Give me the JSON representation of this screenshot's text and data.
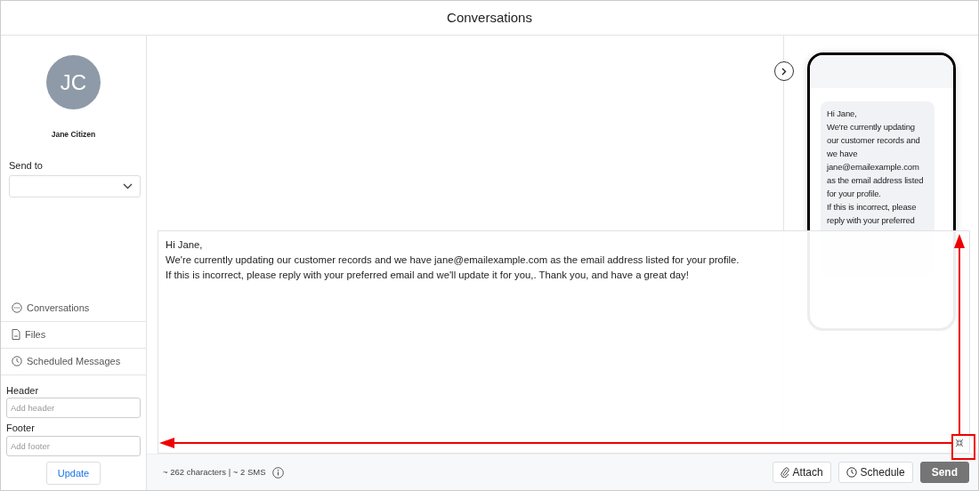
{
  "window": {
    "title": "Conversations"
  },
  "contact": {
    "initials": "JC",
    "name": "Jane Citizen"
  },
  "send_to": {
    "label": "Send to"
  },
  "nav": [
    {
      "label": "Conversations"
    },
    {
      "label": "Files"
    },
    {
      "label": "Scheduled Messages"
    }
  ],
  "header_field": {
    "label": "Header",
    "placeholder": "Add header"
  },
  "footer_field": {
    "label": "Footer",
    "placeholder": "Add footer"
  },
  "update_button": "Update",
  "preview": {
    "message": "Hi Jane,\nWe're currently updating our customer records and we have jane@emailexample.com as the email address listed for your profile.\nIf this is incorrect, please reply with your preferred"
  },
  "composer": {
    "message": "Hi Jane,\nWe're currently updating our customer records and we have jane@emailexample.com as the email address listed for your profile.\nIf this is incorrect, please reply with your preferred email and we'll update it for you,. Thank you, and have a great day!"
  },
  "counter": "~ 262 characters | ~ 2 SMS",
  "actions": [
    {
      "label": "Attach",
      "kind": "attach"
    },
    {
      "label": "Schedule",
      "kind": "schedule"
    },
    {
      "label": "Send",
      "kind": "send"
    }
  ]
}
